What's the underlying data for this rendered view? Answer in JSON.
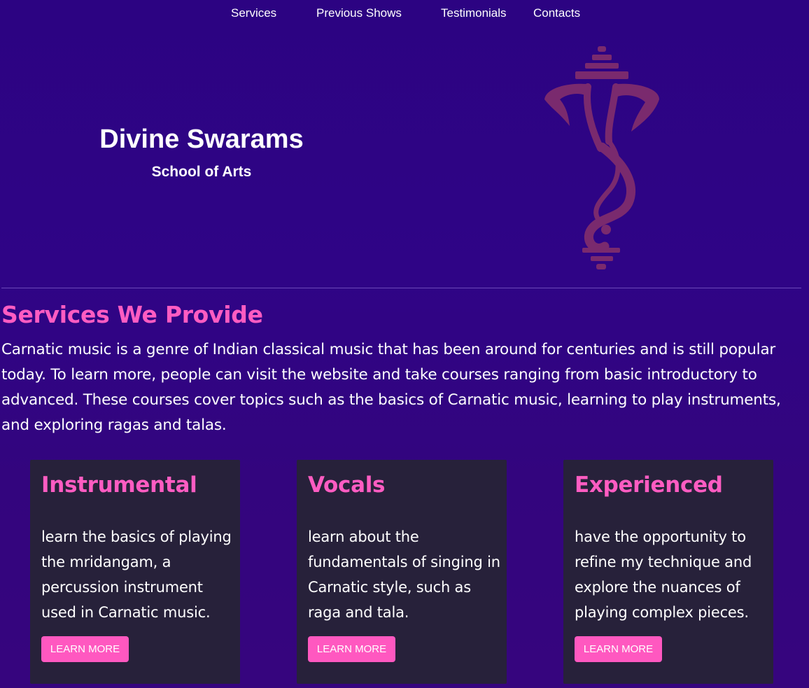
{
  "nav": {
    "items": [
      {
        "label": "Services"
      },
      {
        "label": "Previous Shows"
      },
      {
        "label": "Testimonials"
      },
      {
        "label": "Contacts"
      }
    ]
  },
  "hero": {
    "title": "Divine Swarams",
    "subtitle": "School of Arts",
    "logo_icon": "ganesha-logo-icon",
    "logo_color": "#7a2a6e"
  },
  "services": {
    "title": "Services We Provide",
    "description": "Carnatic music is a genre of Indian classical music that has been around for centuries and is still popular today. To learn more, people can visit the website and take courses ranging from basic introductory to advanced. These courses cover topics such as the basics of Carnatic music, learning to play instruments, and exploring ragas and talas.",
    "cards": [
      {
        "title": "Instrumental",
        "text": "learn the basics of playing the mridangam, a percussion instrument used in Carnatic music.",
        "button": "LEARN MORE"
      },
      {
        "title": "Vocals",
        "text": "learn about the fundamentals of singing in Carnatic style, such as raga and tala.",
        "button": "LEARN MORE"
      },
      {
        "title": "Experienced",
        "text": "have the opportunity to refine my technique and explore the nuances of playing complex pieces.",
        "button": "LEARN MORE"
      }
    ]
  },
  "colors": {
    "background": "#2f0486",
    "accent": "#ff5cc2",
    "card": "#27213a"
  }
}
